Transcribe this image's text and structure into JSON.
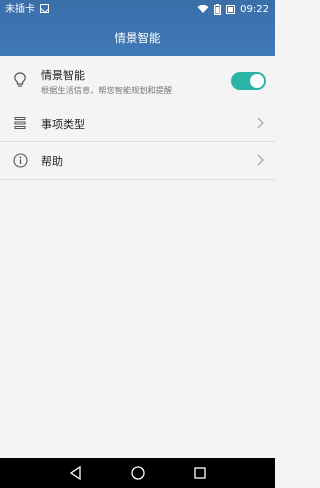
{
  "status_bar": {
    "carrier": "未插卡",
    "sim_icon": "sim-card-icon",
    "wifi_icon": "wifi-icon",
    "battery_icon": "battery-icon",
    "time": "09:22"
  },
  "header": {
    "title": "情景智能"
  },
  "items": [
    {
      "title": "情景智能",
      "subtitle": "根据生活信息，帮您智能规划和提醒",
      "icon": "lightbulb-icon",
      "toggle_on": true
    },
    {
      "title": "事项类型",
      "icon": "list-icon"
    },
    {
      "title": "帮助",
      "icon": "info-icon"
    }
  ],
  "navigation": {
    "back_icon": "back-triangle-icon",
    "home_icon": "home-circle-icon",
    "recents_icon": "recents-square-icon"
  },
  "colors": {
    "header": "#3f79b8",
    "toggle_on": "#2bb3a6"
  }
}
